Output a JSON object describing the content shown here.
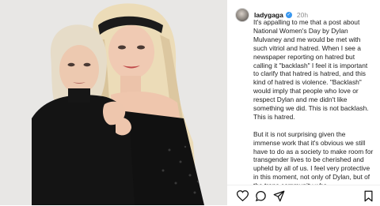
{
  "post": {
    "username": "ladygaga",
    "time": "20h",
    "paragraphs": [
      "It's appalling to me that a post about National Women's Day by Dylan Mulvaney and me would be met with such vitriol and hatred. When I see a newspaper reporting on hatred but calling it \"backlash\" I feel it is important to clarify that hatred is hatred, and this kind of hatred is violence. \"Backlash\" would imply that people who love or respect Dylan and me didn't like something we did. This is not backlash. This is hatred.",
      "But it is not surprising given the immense work that it's obvious we still have to do as a society to make room for transgender lives to be cherished and upheld by all of us. I feel very protective in this moment, not only of Dylan, but of the trans community who"
    ]
  },
  "icons": {
    "verified": "verified-badge-icon",
    "like": "heart-icon",
    "comment": "comment-icon",
    "share": "paper-plane-icon",
    "save": "bookmark-icon"
  },
  "colors": {
    "verified": "#3897f0",
    "text": "#222222",
    "muted": "#8e8e8e"
  }
}
